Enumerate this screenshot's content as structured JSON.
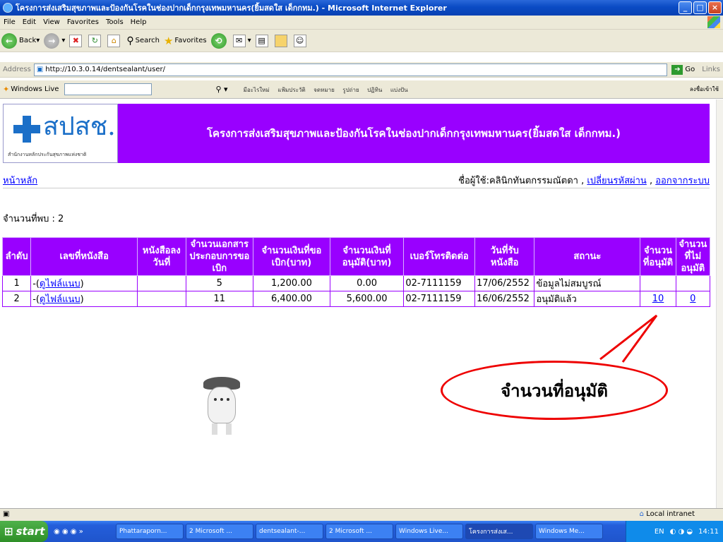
{
  "window": {
    "title": "โครงการส่งเสริมสุขภาพและป้องกันโรคในช่องปากเด็กกรุงเทพมหานคร(ยิ้มสดใส เด็กกทม.) - Microsoft Internet Explorer"
  },
  "menu": [
    "File",
    "Edit",
    "View",
    "Favorites",
    "Tools",
    "Help"
  ],
  "toolbar": {
    "back": "Back",
    "search": "Search",
    "favorites": "Favorites"
  },
  "address": {
    "label": "Address",
    "url": "http://10.3.0.14/dentsealant/user/",
    "go": "Go",
    "links": "Links"
  },
  "windows_live": {
    "label": "Windows Live",
    "links": [
      "มีอะไรใหม่",
      "แฟ้มประวัติ",
      "จดหมาย",
      "รูปถ่าย",
      "ปฏิทิน",
      "แบ่งปัน"
    ],
    "signin": "ลงชื่อเข้าใช้"
  },
  "header": {
    "logo_text": "สปสช.",
    "logo_sub": "สำนักงานหลักประกันสุขภาพแห่งชาติ",
    "title": "โครงการส่งเสริมสุขภาพและป้องกันโรคในช่องปากเด็กกรุงเทพมหานคร(ยิ้มสดใส เด็กกทม.)"
  },
  "nav": {
    "home": "หน้าหลัก",
    "user_label": "ชื่อผู้ใช้:คลินิกทันตกรรมณัตดา ,",
    "change_password": "เปลี่ยนรหัสผ่าน",
    "sep": ",",
    "logout": "ออกจากระบบ"
  },
  "found": "จำนวนที่พบ : 2",
  "table": {
    "headers": [
      "ลำดับ",
      "เลขที่หนังสือ",
      "หนังสือลงวันที่",
      "จำนวนเอกสารประกอบการขอเบิก",
      "จำนวนเงินที่ขอเบิก(บาท)",
      "จำนวนเงินที่อนุมัติ(บาท)",
      "เบอร์โทรติดต่อ",
      "วันที่รับหนังสือ",
      "สถานะ",
      "จำนวนที่อนุมัติ",
      "จำนวนที่ไม่อนุมัติ"
    ],
    "rows": [
      {
        "no": "1",
        "doc_prefix": "-(",
        "doc_link": "ดูไฟล์แนบ",
        "doc_suffix": ")",
        "doc_date": "",
        "attachments": "5",
        "requested": "1,200.00",
        "approved_amount": "0.00",
        "phone": "02-7111159",
        "received": "17/06/2552",
        "status": "ข้อมูลไม่สมบูรณ์",
        "approved_count": "",
        "not_approved_count": ""
      },
      {
        "no": "2",
        "doc_prefix": "-(",
        "doc_link": "ดูไฟล์แนบ",
        "doc_suffix": ")",
        "doc_date": "",
        "attachments": "11",
        "requested": "6,400.00",
        "approved_amount": "5,600.00",
        "phone": "02-7111159",
        "received": "16/06/2552",
        "status": "อนุมัติแล้ว",
        "approved_count": "10",
        "not_approved_count": "0"
      }
    ]
  },
  "callout": "จำนวนที่อนุมัติ",
  "statusbar": {
    "zone": "Local intranet"
  },
  "taskbar": {
    "start": "start",
    "tasks": [
      "Phattaraporn...",
      "2 Microsoft ...",
      "dentsealant-...",
      "2 Microsoft ...",
      "Windows Live...",
      "โครงการส่งเส...",
      "Windows Me..."
    ],
    "lang": "EN",
    "time": "14:11"
  }
}
